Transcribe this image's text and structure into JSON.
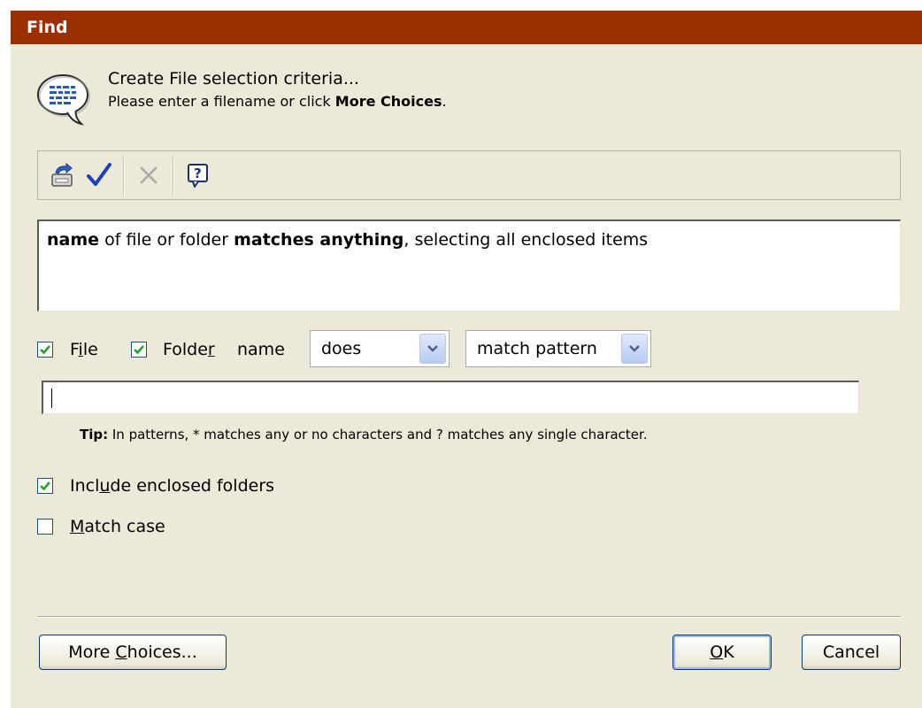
{
  "window": {
    "title": "Find"
  },
  "header": {
    "line1": "Create File selection criteria...",
    "line2_prefix": "Please enter a filename or click ",
    "line2_bold": "More Choices",
    "line2_suffix": "."
  },
  "toolbar": {
    "buttons": [
      {
        "icon": "export-icon",
        "enabled": true
      },
      {
        "icon": "checkmark-icon",
        "enabled": true
      },
      {
        "icon": "delete-icon",
        "enabled": false
      },
      {
        "icon": "help-icon",
        "enabled": true
      }
    ]
  },
  "criteria": {
    "bold1": "name",
    "text1": " of file or folder ",
    "bold2": "matches anything",
    "text2": ", selecting all enclosed items"
  },
  "filter": {
    "file_label_u": "i",
    "file_label_pre": "F",
    "file_label_post": "le",
    "file_checked": true,
    "folder_label_pre": "Folde",
    "folder_label_u": "r",
    "folder_checked": true,
    "name_label": "name",
    "does_select": "does",
    "pattern_select": "match pattern"
  },
  "pattern_input": {
    "value": ""
  },
  "tip": {
    "label": "Tip:",
    "text": " In patterns, * matches any or no characters and ? matches any single character."
  },
  "options": {
    "include_pre": "Incl",
    "include_u": "u",
    "include_post": "de enclosed folders",
    "include_checked": true,
    "match_u": "M",
    "match_post": "atch case",
    "match_checked": false
  },
  "buttons": {
    "more_pre": "More ",
    "more_u": "C",
    "more_post": "hoices...",
    "ok_u": "O",
    "ok_post": "K",
    "cancel": "Cancel"
  },
  "colors": {
    "titlebar": "#9b2f00",
    "dialog_bg": "#ece9d8",
    "checkmark": "#21a121"
  }
}
